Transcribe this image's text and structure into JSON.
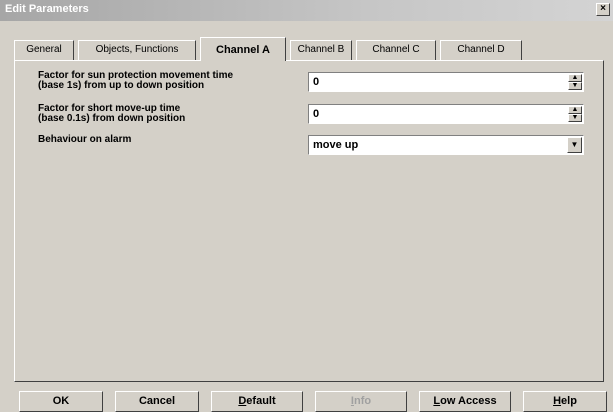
{
  "window": {
    "title": "Edit Parameters",
    "close_glyph": "×"
  },
  "tabs": [
    {
      "label": "General"
    },
    {
      "label": "Objects, Functions"
    },
    {
      "label": "Channel A",
      "active": true
    },
    {
      "label": "Channel B"
    },
    {
      "label": "Channel C"
    },
    {
      "label": "Channel D"
    }
  ],
  "params": [
    {
      "label_line1": "Factor for sun protection movement time",
      "label_line2": "(base 1s) from up to down position",
      "value": "0",
      "control": "spin"
    },
    {
      "label_line1": "Factor for short move-up time",
      "label_line2": "(base 0.1s) from down position",
      "value": "0",
      "control": "spin"
    },
    {
      "label_line1": "Behaviour on alarm",
      "value": "move up",
      "control": "dropdown"
    }
  ],
  "buttons": [
    {
      "label": "OK"
    },
    {
      "label": "Cancel"
    },
    {
      "label": "Default"
    },
    {
      "label": "Info",
      "disabled": true
    },
    {
      "label": "Low Access"
    },
    {
      "label": "Help"
    }
  ],
  "glyphs": {
    "spin_up": "▲",
    "spin_down": "▼",
    "dropdown": "▼"
  }
}
